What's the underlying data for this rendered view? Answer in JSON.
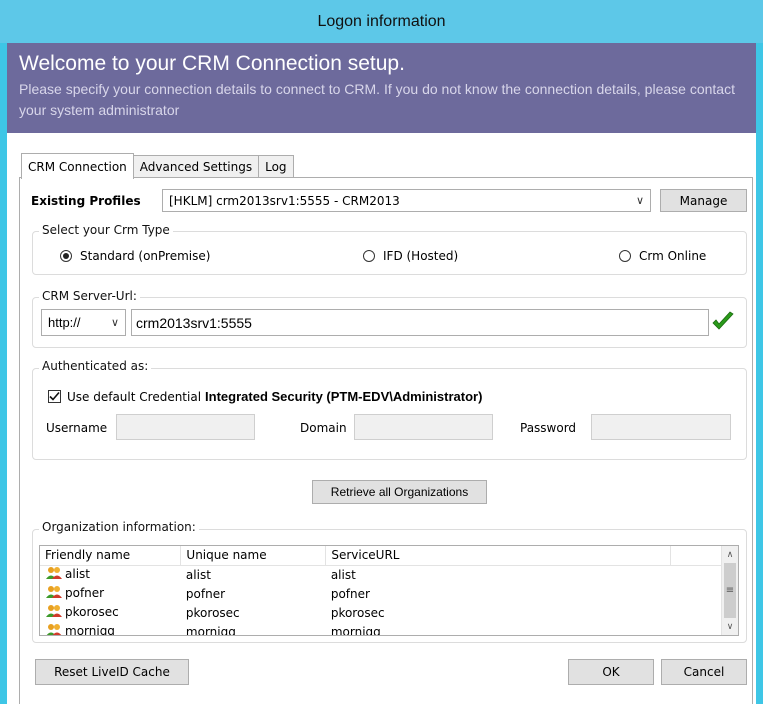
{
  "window": {
    "title": "Logon information"
  },
  "banner": {
    "title": "Welcome to your CRM Connection setup.",
    "description": "Please specify your connection details to connect to CRM. If you do not know the connection details, please contact your system administrator"
  },
  "tabs": [
    {
      "label": "CRM Connection",
      "active": true
    },
    {
      "label": "Advanced Settings",
      "active": false
    },
    {
      "label": "Log",
      "active": false
    }
  ],
  "profiles": {
    "label": "Existing Profiles",
    "selected": "[HKLM] crm2013srv1:5555 - CRM2013",
    "manage_label": "Manage"
  },
  "crm_type": {
    "title": "Select your Crm Type",
    "options": [
      {
        "label": "Standard (onPremise)",
        "selected": true
      },
      {
        "label": "IFD (Hosted)",
        "selected": false
      },
      {
        "label": "Crm Online",
        "selected": false
      }
    ]
  },
  "server": {
    "title": "CRM Server-Url:",
    "protocol": "http://",
    "url": "crm2013srv1:5555",
    "valid_icon": "checkmark-icon"
  },
  "auth": {
    "title": "Authenticated as:",
    "use_default_label": "Use default Credential",
    "use_default_checked": true,
    "identity": "Integrated Security (PTM-EDV\\Administrator)",
    "username_label": "Username",
    "domain_label": "Domain",
    "password_label": "Password",
    "username": "",
    "domain": "",
    "password": ""
  },
  "retrieve_label": "Retrieve all Organizations",
  "organizations": {
    "title": "Organization information:",
    "columns": [
      "Friendly name",
      "Unique name",
      "ServiceURL"
    ],
    "rows": [
      {
        "friendly": "alist",
        "unique": "alist",
        "url": "alist"
      },
      {
        "friendly": "pofner",
        "unique": "pofner",
        "url": "pofner"
      },
      {
        "friendly": "pkorosec",
        "unique": "pkorosec",
        "url": "pkorosec"
      },
      {
        "friendly": "morniqq",
        "unique": "morniqq",
        "url": "morniqq"
      }
    ]
  },
  "footer": {
    "reset_label": "Reset LiveID Cache",
    "ok_label": "OK",
    "cancel_label": "Cancel"
  },
  "colors": {
    "titlebar": "#5dc8e8",
    "banner": "#6d6a9c",
    "valid_check": "#2a9a1a"
  }
}
